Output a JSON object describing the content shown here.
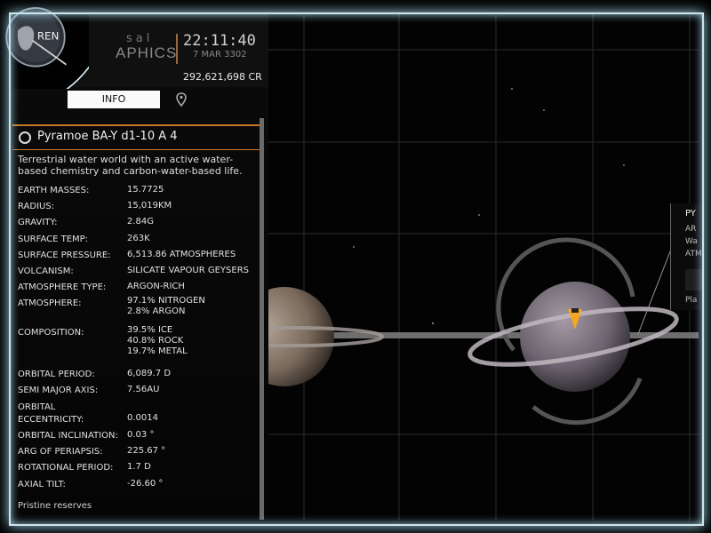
{
  "header": {
    "brand_line1": "sal",
    "brand_line2": "APHICS",
    "logo_text": "REN",
    "time": "22:11:40",
    "date": "7 MAR 3302",
    "credits": "292,621,698 CR"
  },
  "tabs": {
    "info_label": "INFO",
    "pin_icon": "map-pin-icon"
  },
  "body": {
    "name": "Pyramoe BA-Y d1-10 A 4",
    "description": "Terrestrial water world with an active water-based chemistry and carbon-water-based life.",
    "properties": [
      {
        "label": "EARTH MASSES:",
        "value": "15.7725"
      },
      {
        "label": "RADIUS:",
        "value": "15,019KM"
      },
      {
        "label": "GRAVITY:",
        "value": "2.84G"
      },
      {
        "label": "SURFACE TEMP:",
        "value": "263K"
      },
      {
        "label": "SURFACE PRESSURE:",
        "value": "6,513.86 ATMOSPHERES"
      },
      {
        "label": "VOLCANISM:",
        "value": "SILICATE VAPOUR GEYSERS"
      },
      {
        "label": "ATMOSPHERE TYPE:",
        "value": "ARGON-RICH"
      },
      {
        "label": "ATMOSPHERE:",
        "value": "97.1% NITROGEN\n2.8% ARGON"
      },
      {
        "label": "COMPOSITION:",
        "value": "39.5% ICE\n40.8% ROCK\n19.7% METAL"
      },
      {
        "label": "ORBITAL PERIOD:",
        "value": "6,089.7 D"
      },
      {
        "label": "SEMI MAJOR AXIS:",
        "value": "7.56AU"
      },
      {
        "label": "ORBITAL\nECCENTRICITY:",
        "value": "0.0014"
      },
      {
        "label": "ORBITAL INCLINATION:",
        "value": "0.03 °"
      },
      {
        "label": "ARG OF PERIAPSIS:",
        "value": "225.67 °"
      },
      {
        "label": "ROTATIONAL PERIOD:",
        "value": "1.7 D"
      },
      {
        "label": "AXIAL TILT:",
        "value": "-26.60 °"
      }
    ],
    "reserves": "Pristine reserves"
  },
  "callout": {
    "title": "PY",
    "line1": "AR",
    "line2": "Wa",
    "line3": "ATM",
    "line4": "Pla"
  },
  "colors": {
    "accent": "#c7752c",
    "marker": "#f5a623",
    "frame_glow": "#9fd6e8"
  }
}
